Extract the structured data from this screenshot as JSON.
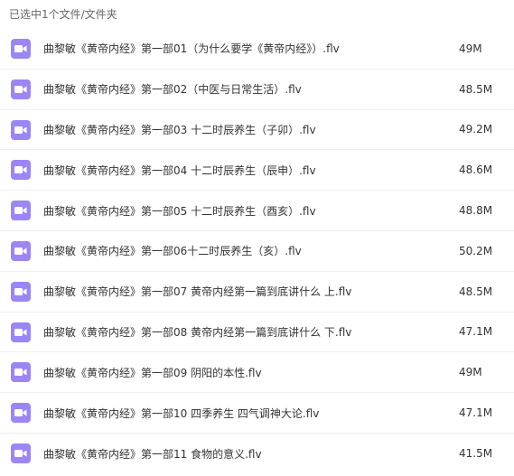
{
  "header": {
    "selection_text": "已选中1个文件/文件夹"
  },
  "colors": {
    "video_icon": "#9b86f4"
  },
  "files": [
    {
      "name": "曲黎敏《黄帝内经》第一部01（为什么要学《黄帝内经》）.flv",
      "size": "49M",
      "icon": "video-file-icon"
    },
    {
      "name": "曲黎敏《黄帝内经》第一部02（中医与日常生活）.flv",
      "size": "48.5M",
      "icon": "video-file-icon"
    },
    {
      "name": "曲黎敏《黄帝内经》第一部03 十二时辰养生（子卯）.flv",
      "size": "49.2M",
      "icon": "video-file-icon"
    },
    {
      "name": "曲黎敏《黄帝内经》第一部04 十二时辰养生（辰申）.flv",
      "size": "48.6M",
      "icon": "video-file-icon"
    },
    {
      "name": "曲黎敏《黄帝内经》第一部05 十二时辰养生（酉亥）.flv",
      "size": "48.8M",
      "icon": "video-file-icon"
    },
    {
      "name": "曲黎敏《黄帝内经》第一部06十二时辰养生（亥）.flv",
      "size": "50.2M",
      "icon": "video-file-icon"
    },
    {
      "name": "曲黎敏《黄帝内经》第一部07 黄帝内经第一篇到底讲什么 上.flv",
      "size": "48.5M",
      "icon": "video-file-icon"
    },
    {
      "name": "曲黎敏《黄帝内经》第一部08 黄帝内经第一篇到底讲什么 下.flv",
      "size": "47.1M",
      "icon": "video-file-icon"
    },
    {
      "name": "曲黎敏《黄帝内经》第一部09 阴阳的本性.flv",
      "size": "49M",
      "icon": "video-file-icon"
    },
    {
      "name": "曲黎敏《黄帝内经》第一部10 四季养生 四气调神大论.flv",
      "size": "47.1M",
      "icon": "video-file-icon"
    },
    {
      "name": "曲黎敏《黄帝内经》第一部11 食物的意义.flv",
      "size": "41.5M",
      "icon": "video-file-icon"
    }
  ]
}
